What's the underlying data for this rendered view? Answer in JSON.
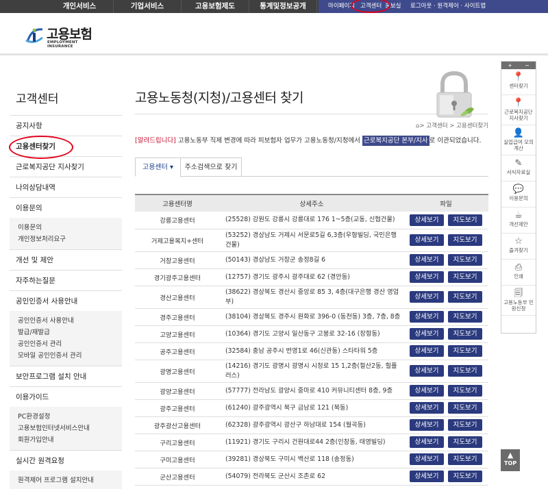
{
  "topnav": {
    "menu": [
      "개인서비스",
      "기업서비스",
      "고용보험제도",
      "통계및정보공개"
    ],
    "util": [
      "마이페이지",
      "고객센터",
      "홍보실",
      "로그아웃 · 원격제어 · 사이트맵"
    ]
  },
  "logo": {
    "title": "고용보험",
    "subtitle": "EMPLOYMENT INSURANCE"
  },
  "sidebar": {
    "title": "고객센터",
    "items": [
      {
        "label": "공지사항"
      },
      {
        "label": "고용센터찾기"
      },
      {
        "label": "근로복지공단 지사찾기"
      },
      {
        "label": "나의상담내역"
      },
      {
        "label": "이용문의",
        "sub": [
          "이용문의",
          "개인정보처리요구"
        ]
      },
      {
        "label": "개선 및 제안"
      },
      {
        "label": "자주하는질문"
      },
      {
        "label": "공인인증서 사용안내",
        "sub": [
          "공인인증서 사용안내",
          "발급/재발급",
          "공인인증서 관리",
          "모바일 공인인증서 관리"
        ]
      },
      {
        "label": "보안프로그램 설치 안내"
      },
      {
        "label": "이용가이드",
        "sub": [
          "PC환경설정",
          "고용보험인터넷서비스안내",
          "회원가입안내"
        ]
      },
      {
        "label": "실시간 원격요청",
        "sub": [
          "원격제어 프로그램 설치안내"
        ]
      }
    ]
  },
  "main": {
    "title": "고용노동청(지청)/고용센터 찾기",
    "breadcrumb": "> 고객센터 > 고용센터찾기",
    "notice_tag": "[알려드립니다]",
    "notice_text": " 고용노동부 직제 변경에 따라 피보험자 업무가 고용노동청/지청에서 ",
    "notice_highlight": "근로복지공단 본부/지사",
    "notice_tail": "로 이관되었습니다.",
    "tabs": [
      "고용센터 ▾",
      "주소검색으로 찾기"
    ]
  },
  "table": {
    "headers": [
      "고용센터명",
      "상세주소",
      "파일"
    ],
    "detail_label": "상세보기",
    "map_label": "지도보기",
    "rows": [
      {
        "name": "강릉고용센터",
        "addr": "(25528) 강원도 강릉시 강릉대로 176 1~5층(교동, 신협건물)"
      },
      {
        "name": "거제고용복지+센터",
        "addr": "(53252) 경상남도 거제시 서문로5길 6,3층(우형빌딩, 국민은행 건물)"
      },
      {
        "name": "거창고용센터",
        "addr": "(50143) 경상남도 거창군 송정8길 6"
      },
      {
        "name": "경기광주고용센터",
        "addr": "(12757) 경기도 광주시 광주대로 62 (경안동)"
      },
      {
        "name": "경산고용센터",
        "addr": "(38622) 경상북도 경산시 중앙로 85 3, 4층(대구은행 경산 영업부)"
      },
      {
        "name": "경주고용센터",
        "addr": "(38104) 경상북도 경주시 원화로 396-0 (동천동) 3층, 7층, 8층"
      },
      {
        "name": "고양고용센터",
        "addr": "(10364) 경기도 고양시 일산동구 고봉로 32-16 (장항동)"
      },
      {
        "name": "공주고용센터",
        "addr": "(32584) 충남 공주시 번영1로 46(신관동) 스타타워 5층"
      },
      {
        "name": "광명고용센터",
        "addr": "(14216) 경기도 광명시 광명시 시청로 15 1,2층(철산2동, 힐플러스)"
      },
      {
        "name": "광양고용센터",
        "addr": "(57777) 전라남도 광양시 중마로 410 커뮤니티센터 8층, 9층"
      },
      {
        "name": "광주고용센터",
        "addr": "(61240) 광주광역시 북구 금남로 121 (북동)"
      },
      {
        "name": "광주광산고용센터",
        "addr": "(62328) 광주광역시 광산구 하남대로 154 (월곡동)"
      },
      {
        "name": "구리고용센터",
        "addr": "(11921) 경기도 구리시 건원대로44 2층(인창동, 태영빌딩)"
      },
      {
        "name": "구미고용센터",
        "addr": "(39281) 경상북도 구미시 백산로 118 (송정동)"
      },
      {
        "name": "군산고용센터",
        "addr": "(54079) 전라북도 군산시 조촌로 62"
      }
    ]
  },
  "quickbar": {
    "controls": [
      "+",
      "−"
    ],
    "items": [
      {
        "label": "센터찾기",
        "icon": "map-pin-icon"
      },
      {
        "label": "근로복지공단 지사찾기",
        "icon": "map-pin-icon"
      },
      {
        "label": "실업급여 모의계산",
        "icon": "person-icon"
      },
      {
        "label": "서식자료실",
        "icon": "edit-icon"
      },
      {
        "label": "이용문의",
        "icon": "chat-icon"
      },
      {
        "label": "개선제안",
        "icon": "cup-icon"
      },
      {
        "label": "즐겨찾기",
        "icon": "star-icon"
      },
      {
        "label": "인쇄",
        "icon": "print-icon"
      },
      {
        "label": "고용노동부 민원신청",
        "icon": "document-icon"
      }
    ]
  },
  "top_button": "TOP"
}
